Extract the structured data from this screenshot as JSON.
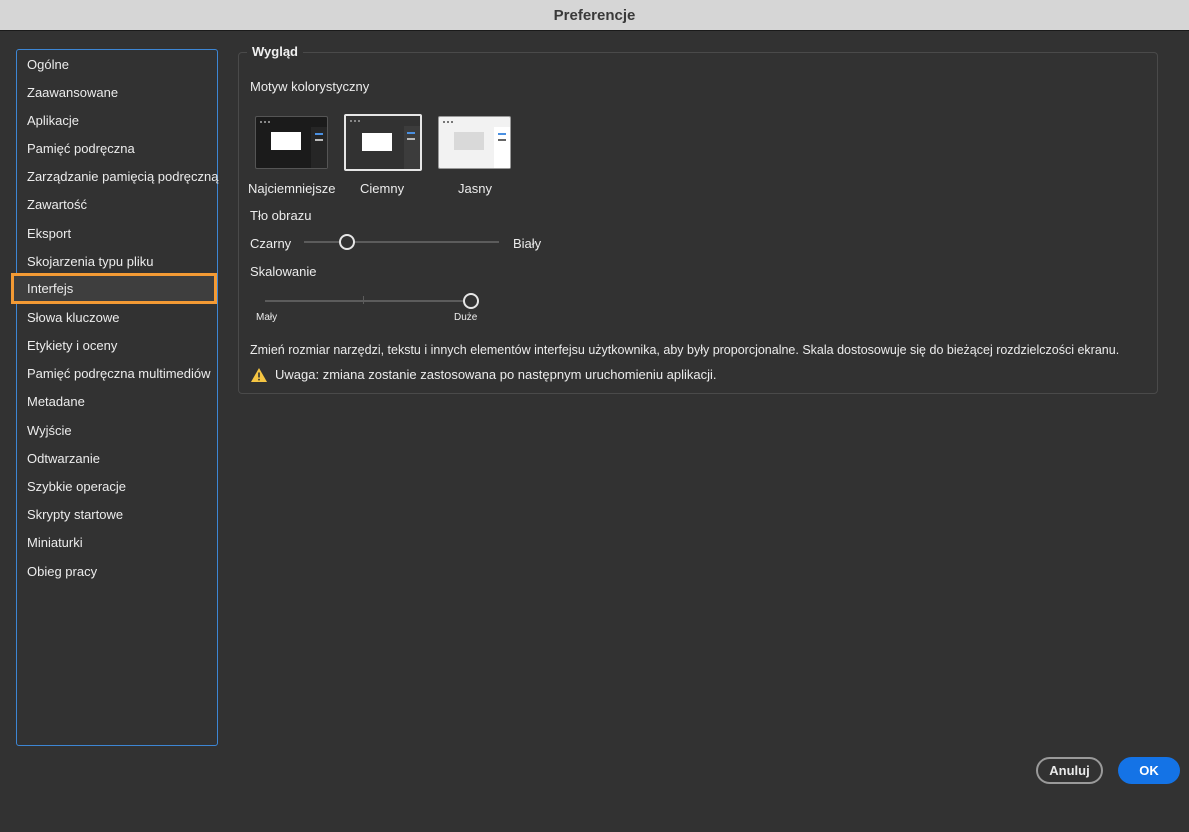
{
  "window": {
    "title": "Preferencje"
  },
  "sidebar": {
    "items": [
      "Ogólne",
      "Zaawansowane",
      "Aplikacje",
      "Pamięć podręczna",
      "Zarządzanie pamięcią podręczną",
      "Zawartość",
      "Eksport",
      "Skojarzenia typu pliku",
      "Interfejs",
      "Słowa kluczowe",
      "Etykiety i oceny",
      "Pamięć podręczna multimediów",
      "Metadane",
      "Wyjście",
      "Odtwarzanie",
      "Szybkie operacje",
      "Skrypty startowe",
      "Miniaturki",
      "Obieg pracy"
    ],
    "selected": "Interfejs"
  },
  "appearance": {
    "legend": "Wygląd",
    "color_theme_label": "Motyw kolorystyczny",
    "themes": [
      "Najciemniejsze",
      "Ciemny",
      "Jasny"
    ],
    "selected_theme": "Ciemny",
    "image_bg": {
      "label": "Tło obrazu",
      "min_label": "Czarny",
      "max_label": "Biały",
      "value_fraction": 0.22
    },
    "scaling": {
      "label": "Skalowanie",
      "min_label": "Mały",
      "max_label": "Duże",
      "value_fraction": 1.0
    },
    "description": "Zmień rozmiar narzędzi, tekstu i innych elementów interfejsu użytkownika, aby były proporcjonalne. Skala dostosowuje się do bieżącej rozdzielczości ekranu.",
    "warning": "Uwaga: zmiana zostanie zastosowana po następnym uruchomieniu aplikacji."
  },
  "buttons": {
    "cancel": "Anuluj",
    "ok": "OK"
  },
  "colors": {
    "accent": "#1473e6",
    "selection": "#f39a34",
    "list_border": "#3d86d4",
    "warning": "#f5c542"
  }
}
